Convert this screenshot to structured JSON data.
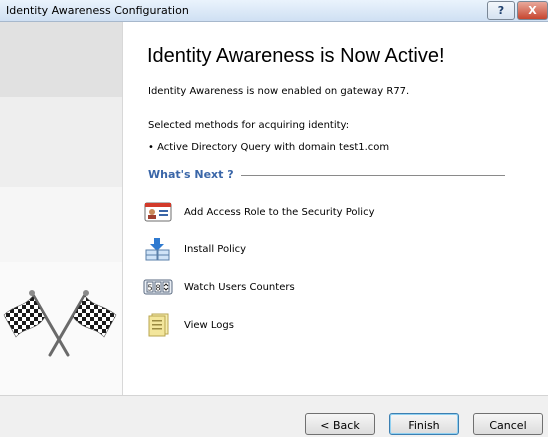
{
  "window": {
    "title": "Identity Awareness Configuration",
    "help_glyph": "?",
    "close_glyph": "X"
  },
  "main": {
    "heading": "Identity Awareness is Now Active!",
    "enabled_text": "Identity Awareness is now enabled on gateway R77.",
    "methods_label": "Selected methods for acquiring identity:",
    "method_item": "• Active Directory Query with domain test1.com",
    "whats_next": "What's Next ?",
    "actions": [
      {
        "label": "Add Access Role to the Security Policy",
        "icon": "access-role-card-icon"
      },
      {
        "label": "Install Policy",
        "icon": "install-policy-icon"
      },
      {
        "label": "Watch Users Counters",
        "icon": "counter-icon"
      },
      {
        "label": "View Logs",
        "icon": "logs-icon"
      }
    ]
  },
  "footer": {
    "back_label": "< Back",
    "finish_label": "Finish",
    "cancel_label": "Cancel"
  },
  "colors": {
    "accent": "#3a66a8",
    "close_red": "#c7462f"
  }
}
